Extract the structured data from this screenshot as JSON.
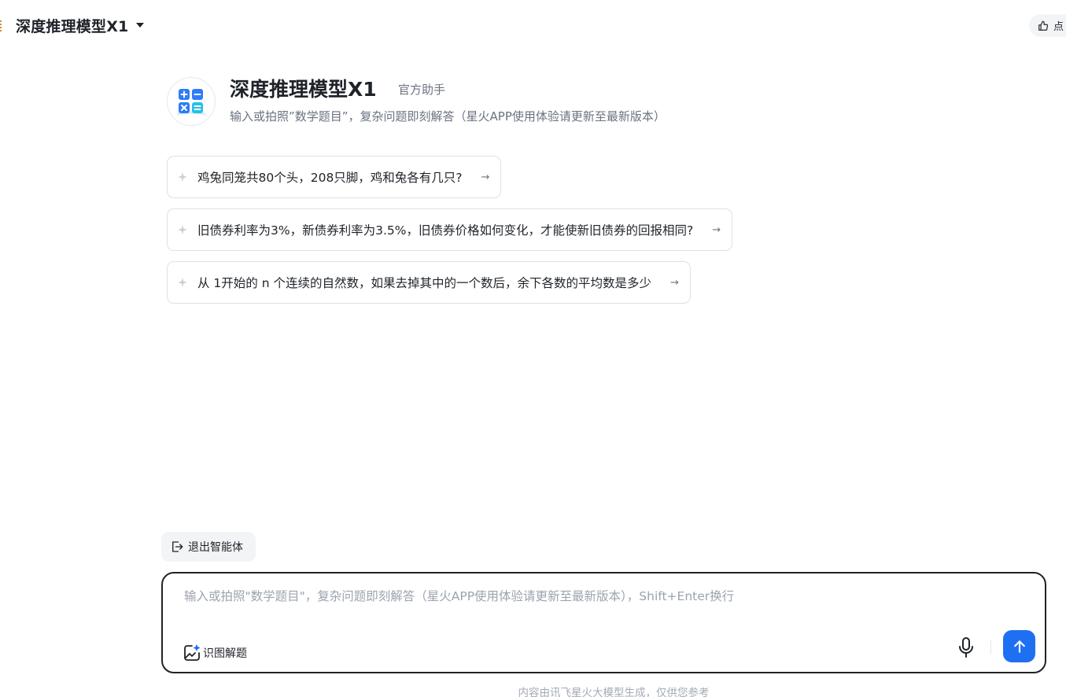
{
  "header": {
    "model_name": "深度推理模型X1",
    "model_dropdown_icon": "caret-down-icon",
    "like_icon": "thumbs-up-icon",
    "like_label": "点"
  },
  "agent": {
    "avatar_icon": "calculator-icon",
    "title": "深度推理模型X1",
    "tag": "官方助手",
    "description": "输入或拍照”数学题目”，复杂问题即刻解答（星火APP使用体验请更新至最新版本）"
  },
  "suggestions": [
    {
      "text": "鸡兔同笼共80个头，208只脚，鸡和兔各有几只?",
      "arrow": "→"
    },
    {
      "text": "旧债券利率为3%，新债券利率为3.5%，旧债券价格如何变化，才能使新旧债券的回报相同?",
      "arrow": "→"
    },
    {
      "text": "从 1开始的 n 个连续的自然数，如果去掉其中的一个数后，余下各数的平均数是多少",
      "arrow": "→"
    }
  ],
  "exit_agent": {
    "label": "退出智能体",
    "icon": "exit-icon"
  },
  "composer": {
    "placeholder": "输入或拍照\"数学题目\"，复杂问题即刻解答（星火APP使用体验请更新至最新版本），Shift+Enter换行",
    "value": "",
    "image_solve_label": "识图解题",
    "image_solve_icon": "image-sparkle-icon",
    "mic_icon": "microphone-icon",
    "send_icon": "arrow-up-icon"
  },
  "footer": {
    "disclaimer": "内容由讯飞星火大模型生成，仅供您参考"
  },
  "colors": {
    "accent": "#1f6ff2",
    "text": "#1f2329",
    "muted": "#6b7280",
    "border": "#dde0e5"
  }
}
